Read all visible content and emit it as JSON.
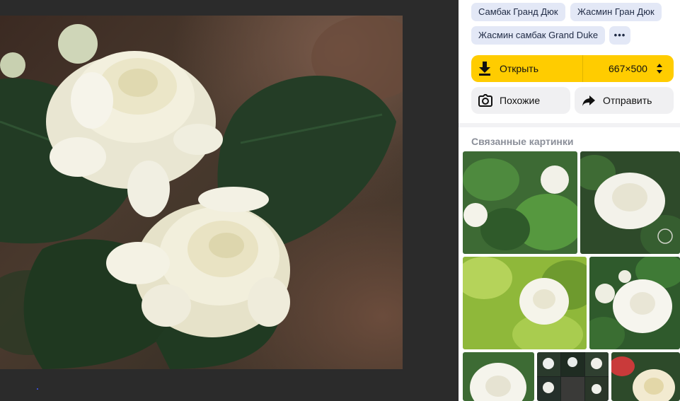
{
  "tags": [
    {
      "label": "Самбак Гранд Дюк"
    },
    {
      "label": "Жасмин Гран Дюк"
    },
    {
      "label": "Жасмин самбак Grand Duke"
    },
    {
      "label": "•••"
    }
  ],
  "actions": {
    "open_label": "Открыть",
    "size_label": "667×500",
    "similar_label": "Похожие",
    "share_label": "Отправить"
  },
  "related": {
    "title": "Связанные картинки"
  },
  "colors": {
    "accent": "#ffcc00",
    "tag_bg": "#e3e8f6",
    "button_gray": "#f0f0f2",
    "viewer_bg": "#2b2b2b"
  },
  "icons": {
    "open": "download-icon",
    "size": "sort-arrows-icon",
    "similar": "camera-lens-icon",
    "share": "share-arrow-icon",
    "more": "ellipsis-icon"
  }
}
